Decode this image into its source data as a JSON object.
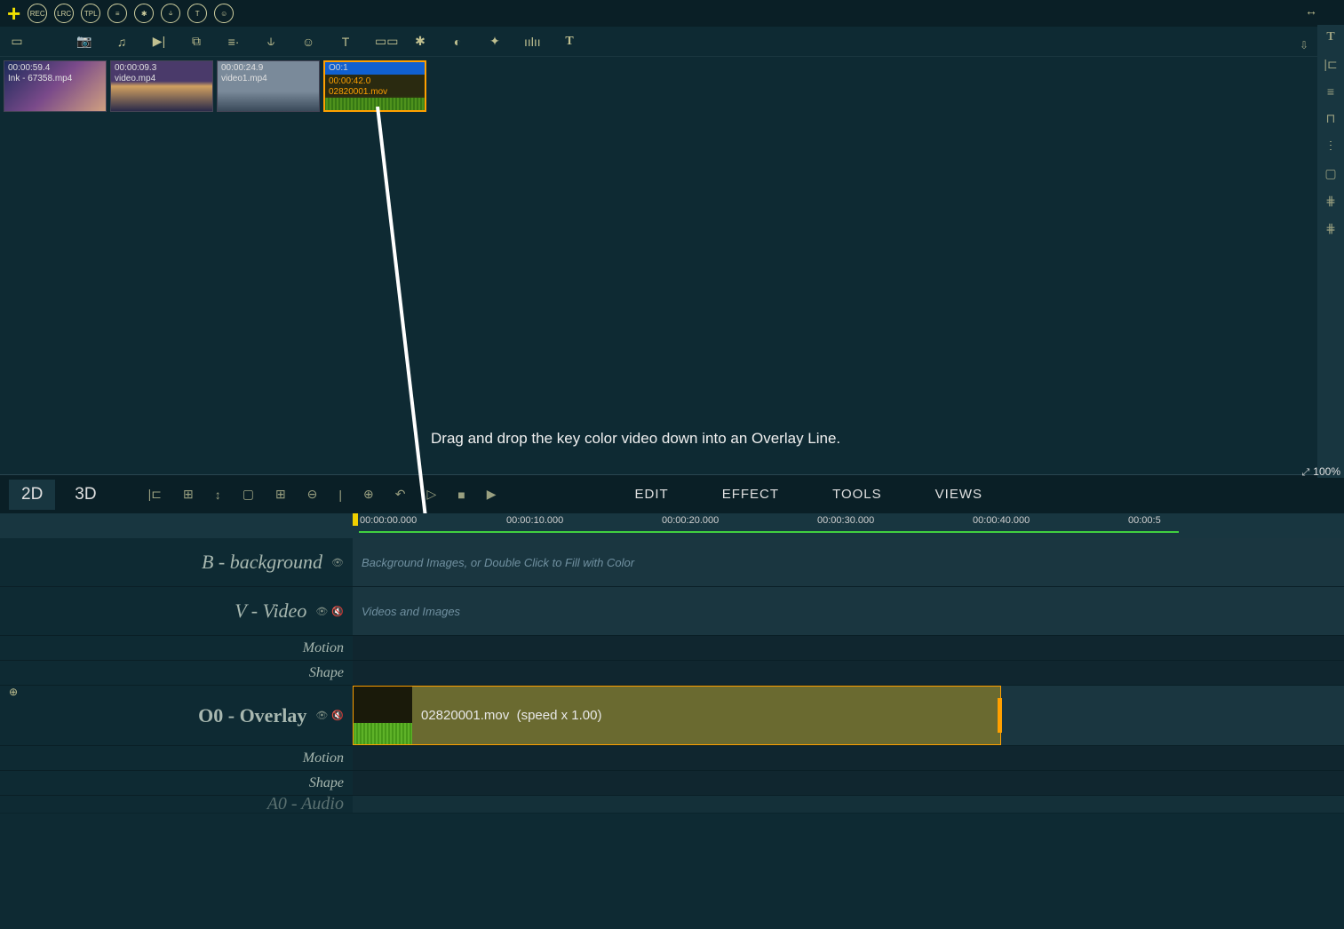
{
  "top_toolbar": {
    "buttons": [
      "REC",
      "LRC",
      "TPL",
      "≡",
      "✱",
      "⫝",
      "T",
      "☺"
    ]
  },
  "secondary_icons": [
    "▭",
    "📷",
    "♫",
    "▶|",
    "⧉",
    "≡·",
    "⫝",
    "☺",
    "T",
    "▭▭",
    "✱",
    "◐",
    "✦",
    "ıılıı",
    "T"
  ],
  "media_clips": [
    {
      "duration": "00:00:59.4",
      "name": "Ink - 67358.mp4"
    },
    {
      "duration": "00:00:09.3",
      "name": "video.mp4"
    },
    {
      "duration": "00:00:24.9",
      "name": "video1.mp4"
    },
    {
      "overlay_label": "O0:1",
      "duration": "00:00:42.0",
      "name": "02820001.mov"
    }
  ],
  "right_side_icons": [
    "T",
    "|⊏",
    "≡",
    "⊓",
    "ⵗ",
    "▢",
    "⋕",
    "⋕"
  ],
  "zoom": "100%",
  "instruction": "Drag and drop the key color video down into an Overlay Line.",
  "view_tabs": {
    "tab1": "2D",
    "tab2": "3D"
  },
  "timeline_tools": [
    "|⊏",
    "⊞",
    "↕",
    "▢",
    "⊞",
    "⊖",
    "|",
    "⊕",
    "↶",
    "▷",
    "■",
    "▶"
  ],
  "timeline_menus": {
    "m1": "EDIT",
    "m2": "EFFECT",
    "m3": "TOOLS",
    "m4": "VIEWS"
  },
  "time_ticks": [
    "00:00:00.000",
    "00:00:10.000",
    "00:00:20.000",
    "00:00:30.000",
    "00:00:40.000",
    "00:00:5"
  ],
  "tracks": {
    "bg": {
      "label": "B - background",
      "hint": "Background Images, or Double Click to Fill with Color"
    },
    "video": {
      "label": "V - Video",
      "hint": "Videos and Images"
    },
    "motion": "Motion",
    "shape": "Shape",
    "overlay": {
      "label": "O0 - Overlay"
    },
    "audio": "A0 - Audio"
  },
  "overlay_clip": {
    "name": "02820001.mov",
    "speed": "(speed x 1.00)"
  }
}
